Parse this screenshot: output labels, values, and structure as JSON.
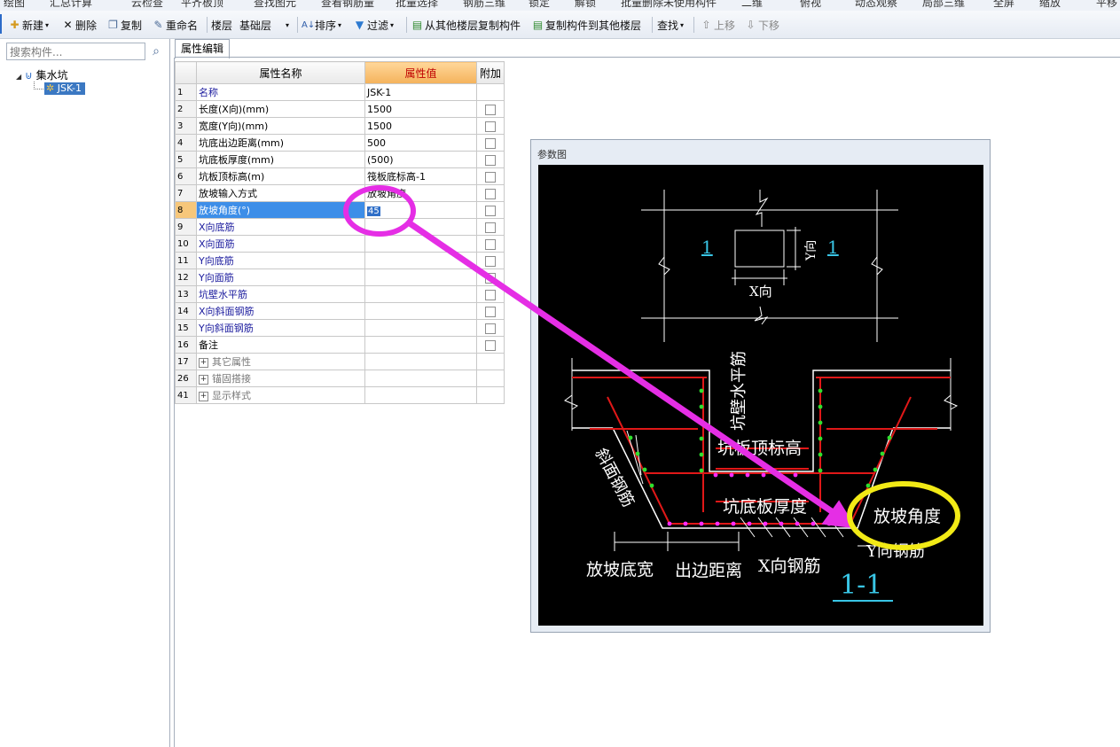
{
  "top_strip": [
    "绘图",
    "汇总计算",
    "云检查",
    "平齐板顶",
    "查找图元",
    "查看钢筋量",
    "批量选择",
    "钢筋三维",
    "锁定",
    "解锁",
    "批量删除未使用构件",
    "二维",
    "俯视",
    "动态观察",
    "局部三维",
    "全屏",
    "缩放",
    "平移"
  ],
  "toolbar": {
    "new": "新建",
    "delete": "删除",
    "copy": "复制",
    "rename": "重命名",
    "floor_label": "楼层",
    "floor_value": "基础层",
    "sort": "排序",
    "filter": "过滤",
    "copy_from_other_floor": "从其他楼层复制构件",
    "copy_to_other_floor": "复制构件到其他楼层",
    "find": "查找",
    "move_up": "上移",
    "move_down": "下移"
  },
  "left_panel": {
    "search_placeholder": "搜索构件...",
    "tree_root": "集水坑",
    "tree_child": "JSK-1"
  },
  "tab_label": "属性编辑",
  "grid": {
    "headers": [
      "属性名称",
      "属性值",
      "附加"
    ],
    "rows": [
      {
        "num": "1",
        "name": "名称",
        "value": "JSK-1"
      },
      {
        "num": "2",
        "name": "长度(X向)(mm)",
        "value": "1500"
      },
      {
        "num": "3",
        "name": "宽度(Y向)(mm)",
        "value": "1500"
      },
      {
        "num": "4",
        "name": "坑底出边距离(mm)",
        "value": "500"
      },
      {
        "num": "5",
        "name": "坑底板厚度(mm)",
        "value": "(500)"
      },
      {
        "num": "6",
        "name": "坑板顶标高(m)",
        "value": "筏板底标高-1"
      },
      {
        "num": "7",
        "name": "放坡输入方式",
        "value": "放坡角度"
      },
      {
        "num": "8",
        "name": "放坡角度(°)",
        "value": "45"
      },
      {
        "num": "9",
        "name": "X向底筋",
        "value": ""
      },
      {
        "num": "10",
        "name": "X向面筋",
        "value": ""
      },
      {
        "num": "11",
        "name": "Y向底筋",
        "value": ""
      },
      {
        "num": "12",
        "name": "Y向面筋",
        "value": ""
      },
      {
        "num": "13",
        "name": "坑壁水平筋",
        "value": ""
      },
      {
        "num": "14",
        "name": "X向斜面钢筋",
        "value": ""
      },
      {
        "num": "15",
        "name": "Y向斜面钢筋",
        "value": ""
      },
      {
        "num": "16",
        "name": "备注",
        "value": ""
      },
      {
        "num": "17",
        "name": "其它属性",
        "value": ""
      },
      {
        "num": "26",
        "name": "锚固搭接",
        "value": ""
      },
      {
        "num": "41",
        "name": "显示样式",
        "value": ""
      }
    ]
  },
  "param_panel": {
    "title": "参数图",
    "labels": {
      "section_mark": "1",
      "x_dir": "X向",
      "y_dir": "Y向",
      "wall_horizontal_bar": "坑壁水平筋",
      "top_elevation": "坑板顶标高",
      "slope_bar": "斜面钢筋",
      "bottom_thickness": "坑底板厚度",
      "slope_angle": "放坡角度",
      "y_bar": "Y向钢筋",
      "slope_bottom_width": "放坡底宽",
      "edge_distance": "出边距离",
      "x_bar": "X向钢筋",
      "section_title": "1-1"
    }
  },
  "colors": {
    "selection_blue": "#3d8ee8",
    "header_orange": "#f4b25b",
    "annotation_magenta": "#e52ee5",
    "annotation_yellow": "#f2ea16",
    "rebar_red": "#e01818",
    "rebar_green": "#2ee02e",
    "rebar_magenta": "#ff2bff"
  }
}
